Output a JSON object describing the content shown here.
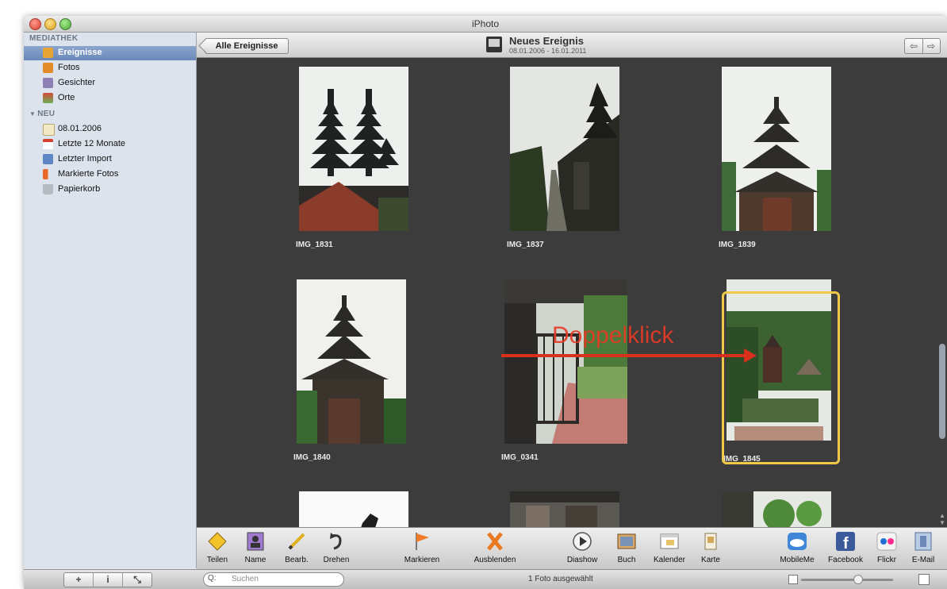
{
  "window": {
    "title": "iPhoto"
  },
  "sidebar": {
    "header_library": "MEDIATHEK",
    "library_items": [
      {
        "label": "Ereignisse",
        "icon": "events-icon",
        "selected": true
      },
      {
        "label": "Fotos",
        "icon": "photos-icon"
      },
      {
        "label": "Gesichter",
        "icon": "faces-icon"
      },
      {
        "label": "Orte",
        "icon": "places-icon"
      }
    ],
    "header_new": "NEU",
    "new_items": [
      {
        "label": "08.01.2006",
        "icon": "event-icon"
      },
      {
        "label": "Letzte 12 Monate",
        "icon": "calendar-icon"
      },
      {
        "label": "Letzter Import",
        "icon": "import-icon"
      },
      {
        "label": "Markierte Fotos",
        "icon": "flag-icon"
      },
      {
        "label": "Papierkorb",
        "icon": "trash-icon"
      }
    ]
  },
  "topbar": {
    "back_label": "Alle Ereignisse",
    "event_title": "Neues Ereignis",
    "event_dates": "08.01.2006 - 16.01.2011",
    "nav_prev": "⇦",
    "nav_next": "⇨"
  },
  "photos": [
    {
      "name": "IMG_1831"
    },
    {
      "name": "IMG_1837"
    },
    {
      "name": "IMG_1839"
    },
    {
      "name": "IMG_1840"
    },
    {
      "name": "IMG_0341"
    },
    {
      "name": "IMG_1845",
      "selected": true
    }
  ],
  "annotation": {
    "text": "Doppelklick",
    "color": "#e53a25"
  },
  "toolbar": {
    "items": [
      {
        "label": "Teilen",
        "icon": "share-icon"
      },
      {
        "label": "Name",
        "icon": "name-icon"
      },
      {
        "label": "Bearb.",
        "icon": "edit-icon"
      },
      {
        "label": "Drehen",
        "icon": "rotate-icon"
      },
      {
        "label": "Markieren",
        "icon": "flag-icon"
      },
      {
        "label": "Ausblenden",
        "icon": "hide-icon"
      },
      {
        "label": "Diashow",
        "icon": "slideshow-icon"
      },
      {
        "label": "Buch",
        "icon": "book-icon"
      },
      {
        "label": "Kalender",
        "icon": "calendar-icon"
      },
      {
        "label": "Karte",
        "icon": "card-icon"
      },
      {
        "label": "MobileMe",
        "icon": "mobileme-icon"
      },
      {
        "label": "Facebook",
        "icon": "facebook-icon"
      },
      {
        "label": "Flickr",
        "icon": "flickr-icon"
      },
      {
        "label": "E-Mail",
        "icon": "email-icon"
      }
    ]
  },
  "statusbar": {
    "add_label": "+",
    "info_label": "i",
    "fullscreen_label": "⤡",
    "search_placeholder": "Suchen",
    "status_text": "1 Foto ausgewählt",
    "zoom_level": 0.62
  },
  "colors": {
    "selection": "#f1c94a",
    "sidebar_bg": "#dce3ec",
    "grid_bg": "#3c3c3c"
  }
}
